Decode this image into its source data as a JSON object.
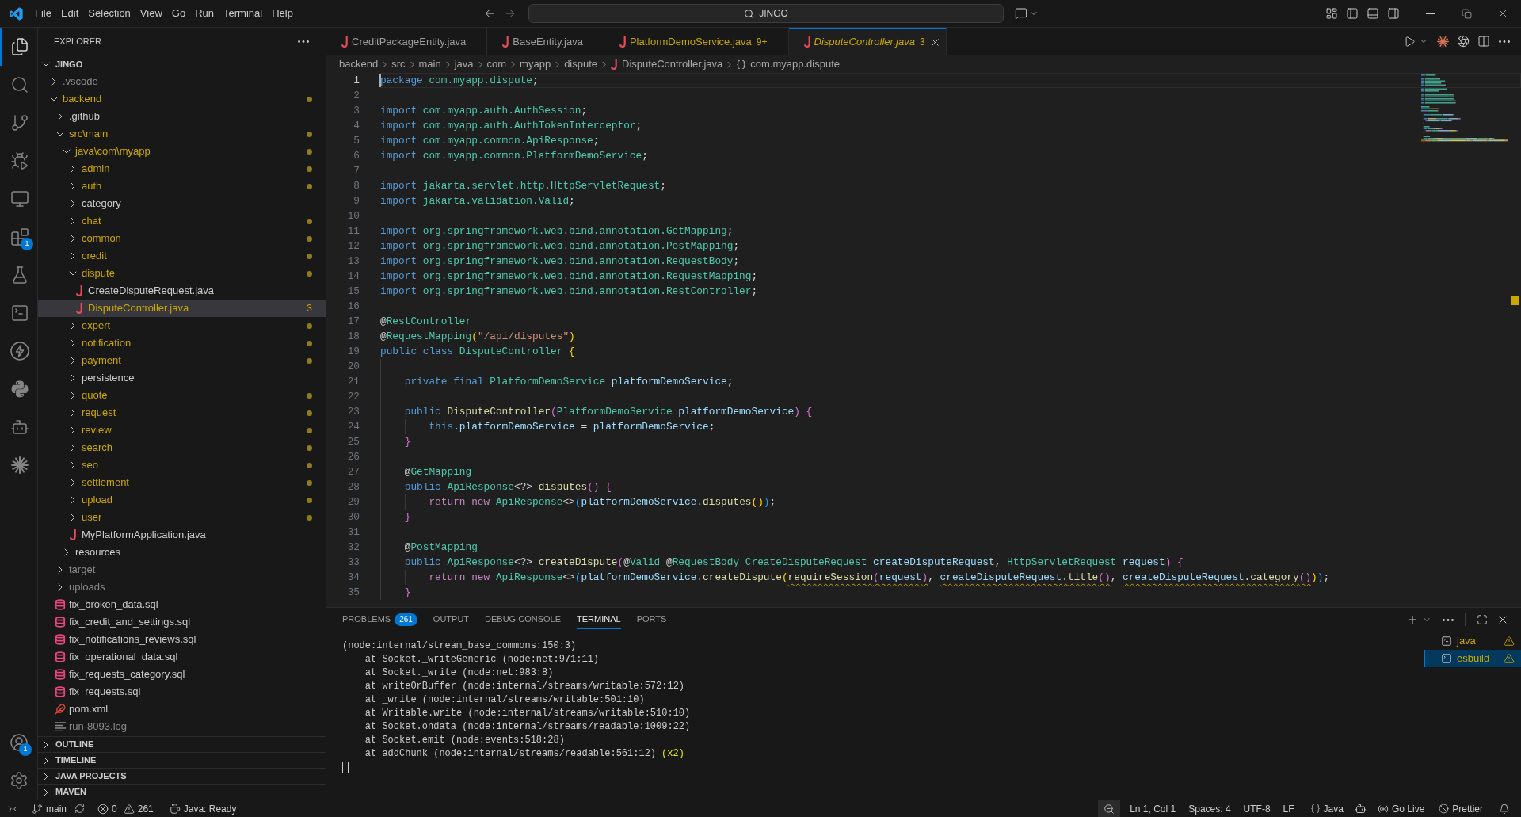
{
  "title_bar": {
    "menu": [
      "File",
      "Edit",
      "Selection",
      "View",
      "Go",
      "Run",
      "Terminal",
      "Help"
    ],
    "command_center": {
      "label": "JINGO"
    }
  },
  "activity_bar": {
    "items": [
      {
        "selected": true
      },
      {
        "selected": false
      },
      {
        "selected": false
      },
      {
        "selected": false
      },
      {
        "selected": false
      },
      {
        "selected": false,
        "badge": "1"
      },
      {
        "selected": false
      },
      {
        "selected": false
      },
      {
        "selected": false
      },
      {
        "selected": false
      },
      {
        "selected": false
      },
      {
        "selected": false
      }
    ],
    "accounts": {
      "badge": "1"
    }
  },
  "sidebar": {
    "title": "EXPLORER",
    "workspace": {
      "name": "JINGO",
      "expanded": true
    },
    "tree": [
      {
        "name": ".vscode",
        "kind": "folder",
        "expanded": false,
        "warning": false,
        "dimmed": true,
        "selected": false
      },
      {
        "name": "backend",
        "kind": "folder",
        "expanded": true,
        "warning": true,
        "dimmed": false,
        "selected": false,
        "children": [
          {
            "name": ".github",
            "kind": "folder",
            "expanded": false,
            "warning": false,
            "dimmed": false,
            "selected": false
          },
          {
            "name": "src\\main",
            "kind": "folder",
            "expanded": true,
            "warning": true,
            "dimmed": false,
            "selected": false,
            "children": [
              {
                "name": "java\\com\\myapp",
                "kind": "folder",
                "expanded": true,
                "warning": true,
                "dimmed": false,
                "selected": false,
                "children": [
                  {
                    "name": "admin",
                    "kind": "folder",
                    "expanded": false,
                    "warning": true,
                    "dimmed": false,
                    "selected": false
                  },
                  {
                    "name": "auth",
                    "kind": "folder",
                    "expanded": false,
                    "warning": true,
                    "dimmed": false,
                    "selected": false
                  },
                  {
                    "name": "category",
                    "kind": "folder",
                    "expanded": false,
                    "warning": false,
                    "dimmed": false,
                    "selected": false
                  },
                  {
                    "name": "chat",
                    "kind": "folder",
                    "expanded": false,
                    "warning": true,
                    "dimmed": false,
                    "selected": false
                  },
                  {
                    "name": "common",
                    "kind": "folder",
                    "expanded": false,
                    "warning": true,
                    "dimmed": false,
                    "selected": false
                  },
                  {
                    "name": "credit",
                    "kind": "folder",
                    "expanded": false,
                    "warning": true,
                    "dimmed": false,
                    "selected": false
                  },
                  {
                    "name": "dispute",
                    "kind": "folder",
                    "expanded": true,
                    "warning": true,
                    "dimmed": false,
                    "selected": false,
                    "children": [
                      {
                        "name": "CreateDisputeRequest.java",
                        "kind": "java",
                        "warning": false,
                        "dimmed": false,
                        "selected": false
                      },
                      {
                        "name": "DisputeController.java",
                        "kind": "java",
                        "warning": true,
                        "dimmed": false,
                        "selected": true,
                        "badge": "3"
                      }
                    ]
                  },
                  {
                    "name": "expert",
                    "kind": "folder",
                    "expanded": false,
                    "warning": true,
                    "dimmed": false,
                    "selected": false
                  },
                  {
                    "name": "notification",
                    "kind": "folder",
                    "expanded": false,
                    "warning": true,
                    "dimmed": false,
                    "selected": false
                  },
                  {
                    "name": "payment",
                    "kind": "folder",
                    "expanded": false,
                    "warning": true,
                    "dimmed": false,
                    "selected": false
                  },
                  {
                    "name": "persistence",
                    "kind": "folder",
                    "expanded": false,
                    "warning": false,
                    "dimmed": false,
                    "selected": false
                  },
                  {
                    "name": "quote",
                    "kind": "folder",
                    "expanded": false,
                    "warning": true,
                    "dimmed": false,
                    "selected": false
                  },
                  {
                    "name": "request",
                    "kind": "folder",
                    "expanded": false,
                    "warning": true,
                    "dimmed": false,
                    "selected": false
                  },
                  {
                    "name": "review",
                    "kind": "folder",
                    "expanded": false,
                    "warning": true,
                    "dimmed": false,
                    "selected": false
                  },
                  {
                    "name": "search",
                    "kind": "folder",
                    "expanded": false,
                    "warning": true,
                    "dimmed": false,
                    "selected": false
                  },
                  {
                    "name": "seo",
                    "kind": "folder",
                    "expanded": false,
                    "warning": true,
                    "dimmed": false,
                    "selected": false
                  },
                  {
                    "name": "settlement",
                    "kind": "folder",
                    "expanded": false,
                    "warning": true,
                    "dimmed": false,
                    "selected": false
                  },
                  {
                    "name": "upload",
                    "kind": "folder",
                    "expanded": false,
                    "warning": true,
                    "dimmed": false,
                    "selected": false
                  },
                  {
                    "name": "user",
                    "kind": "folder",
                    "expanded": false,
                    "warning": true,
                    "dimmed": false,
                    "selected": false
                  },
                  {
                    "name": "MyPlatformApplication.java",
                    "kind": "java",
                    "warning": false,
                    "dimmed": false,
                    "selected": false
                  }
                ]
              },
              {
                "name": "resources",
                "kind": "folder",
                "expanded": false,
                "warning": false,
                "dimmed": false,
                "selected": false
              }
            ]
          },
          {
            "name": "target",
            "kind": "folder",
            "expanded": false,
            "warning": false,
            "dimmed": true,
            "selected": false
          },
          {
            "name": "uploads",
            "kind": "folder",
            "expanded": false,
            "warning": false,
            "dimmed": true,
            "selected": false
          },
          {
            "name": "fix_broken_data.sql",
            "kind": "sql",
            "warning": false,
            "dimmed": false,
            "selected": false
          },
          {
            "name": "fix_credit_and_settings.sql",
            "kind": "sql",
            "warning": false,
            "dimmed": false,
            "selected": false
          },
          {
            "name": "fix_notifications_reviews.sql",
            "kind": "sql",
            "warning": false,
            "dimmed": false,
            "selected": false
          },
          {
            "name": "fix_operational_data.sql",
            "kind": "sql",
            "warning": false,
            "dimmed": false,
            "selected": false
          },
          {
            "name": "fix_requests_category.sql",
            "kind": "sql",
            "warning": false,
            "dimmed": false,
            "selected": false
          },
          {
            "name": "fix_requests.sql",
            "kind": "sql",
            "warning": false,
            "dimmed": false,
            "selected": false
          },
          {
            "name": "pom.xml",
            "kind": "xml",
            "warning": false,
            "dimmed": false,
            "selected": false
          },
          {
            "name": "run-8093.log",
            "kind": "log",
            "warning": false,
            "dimmed": true,
            "selected": false
          }
        ]
      }
    ],
    "sections": [
      {
        "name": "OUTLINE",
        "expanded": false
      },
      {
        "name": "TIMELINE",
        "expanded": false
      },
      {
        "name": "JAVA PROJECTS",
        "expanded": false
      },
      {
        "name": "MAVEN",
        "expanded": false
      }
    ]
  },
  "editor": {
    "tabs": [
      {
        "name": "CreditPackageEntity.java",
        "selected": false,
        "preview": false,
        "warning": false
      },
      {
        "name": "BaseEntity.java",
        "selected": false,
        "preview": false,
        "warning": false
      },
      {
        "name": "PlatformDemoService.java",
        "selected": false,
        "preview": false,
        "warning": true,
        "problems": "9+"
      },
      {
        "name": "DisputeController.java",
        "selected": true,
        "preview": true,
        "warning": true,
        "problems": "3"
      }
    ],
    "breadcrumb": [
      {
        "label": "backend",
        "kind": "folder"
      },
      {
        "label": "src",
        "kind": "folder"
      },
      {
        "label": "main",
        "kind": "folder"
      },
      {
        "label": "java",
        "kind": "folder"
      },
      {
        "label": "com",
        "kind": "folder"
      },
      {
        "label": "myapp",
        "kind": "folder"
      },
      {
        "label": "dispute",
        "kind": "folder"
      },
      {
        "label": "DisputeController.java",
        "kind": "file"
      },
      {
        "label": "com.myapp.dispute",
        "kind": "symbol"
      }
    ],
    "lines": [
      {
        "number": "1",
        "current": true,
        "tokens": [
          {
            "kind": "keyword",
            "text": "package "
          },
          {
            "kind": "type",
            "text": "com.myapp.dispute"
          },
          {
            "kind": "plain",
            "text": ";"
          }
        ]
      },
      {
        "number": "2",
        "current": false
      },
      {
        "number": "3",
        "current": false,
        "tokens": [
          {
            "kind": "keyword",
            "text": "import "
          },
          {
            "kind": "type",
            "text": "com.myapp.auth.AuthSession"
          },
          {
            "kind": "plain",
            "text": ";"
          }
        ]
      },
      {
        "number": "4",
        "current": false,
        "tokens": [
          {
            "kind": "keyword",
            "text": "import "
          },
          {
            "kind": "type",
            "text": "com.myapp.auth.AuthTokenInterceptor"
          },
          {
            "kind": "plain",
            "text": ";"
          }
        ]
      },
      {
        "number": "5",
        "current": false,
        "tokens": [
          {
            "kind": "keyword",
            "text": "import "
          },
          {
            "kind": "type",
            "text": "com.myapp.common.ApiResponse"
          },
          {
            "kind": "plain",
            "text": ";"
          }
        ]
      },
      {
        "number": "6",
        "current": false,
        "tokens": [
          {
            "kind": "keyword",
            "text": "import "
          },
          {
            "kind": "type",
            "text": "com.myapp.common.PlatformDemoService"
          },
          {
            "kind": "plain",
            "text": ";"
          }
        ]
      },
      {
        "number": "7",
        "current": false
      },
      {
        "number": "8",
        "current": false,
        "tokens": [
          {
            "kind": "keyword",
            "text": "import "
          },
          {
            "kind": "type",
            "text": "jakarta.servlet.http.HttpServletRequest"
          },
          {
            "kind": "plain",
            "text": ";"
          }
        ]
      },
      {
        "number": "9",
        "current": false,
        "tokens": [
          {
            "kind": "keyword",
            "text": "import "
          },
          {
            "kind": "type",
            "text": "jakarta.validation.Valid"
          },
          {
            "kind": "plain",
            "text": ";"
          }
        ]
      },
      {
        "number": "10",
        "current": false
      },
      {
        "number": "11",
        "current": false,
        "tokens": [
          {
            "kind": "keyword",
            "text": "import "
          },
          {
            "kind": "type",
            "text": "org.springframework.web.bind.annotation.GetMapping"
          },
          {
            "kind": "plain",
            "text": ";"
          }
        ]
      },
      {
        "number": "12",
        "current": false,
        "tokens": [
          {
            "kind": "keyword",
            "text": "import "
          },
          {
            "kind": "type",
            "text": "org.springframework.web.bind.annotation.PostMapping"
          },
          {
            "kind": "plain",
            "text": ";"
          }
        ]
      },
      {
        "number": "13",
        "current": false,
        "tokens": [
          {
            "kind": "keyword",
            "text": "import "
          },
          {
            "kind": "type",
            "text": "org.springframework.web.bind.annotation.RequestBody"
          },
          {
            "kind": "plain",
            "text": ";"
          }
        ]
      },
      {
        "number": "14",
        "current": false,
        "tokens": [
          {
            "kind": "keyword",
            "text": "import "
          },
          {
            "kind": "type",
            "text": "org.springframework.web.bind.annotation.RequestMapping"
          },
          {
            "kind": "plain",
            "text": ";"
          }
        ]
      },
      {
        "number": "15",
        "current": false,
        "tokens": [
          {
            "kind": "keyword",
            "text": "import "
          },
          {
            "kind": "type",
            "text": "org.springframework.web.bind.annotation.RestController"
          },
          {
            "kind": "plain",
            "text": ";"
          }
        ]
      },
      {
        "number": "16",
        "current": false
      },
      {
        "number": "17",
        "current": false,
        "tokens": [
          {
            "kind": "plain",
            "text": "@"
          },
          {
            "kind": "type",
            "text": "RestController"
          }
        ]
      },
      {
        "number": "18",
        "current": false,
        "tokens": [
          {
            "kind": "plain",
            "text": "@"
          },
          {
            "kind": "type",
            "text": "RequestMapping"
          },
          {
            "kind": "bracket1",
            "text": "("
          },
          {
            "kind": "string",
            "text": "\"/api/disputes\""
          },
          {
            "kind": "bracket1",
            "text": ")"
          }
        ]
      },
      {
        "number": "19",
        "current": false,
        "tokens": [
          {
            "kind": "keyword",
            "text": "public class "
          },
          {
            "kind": "type",
            "text": "DisputeController "
          },
          {
            "kind": "bracket1",
            "text": "{"
          }
        ]
      },
      {
        "number": "20",
        "current": false
      },
      {
        "number": "21",
        "current": false,
        "tokens": [
          {
            "kind": "keyword",
            "text": "    private final "
          },
          {
            "kind": "type",
            "text": "PlatformDemoService "
          },
          {
            "kind": "variable",
            "text": "platformDemoService"
          },
          {
            "kind": "plain",
            "text": ";"
          }
        ]
      },
      {
        "number": "22",
        "current": false
      },
      {
        "number": "23",
        "current": false,
        "tokens": [
          {
            "kind": "keyword",
            "text": "    public "
          },
          {
            "kind": "function",
            "text": "DisputeController"
          },
          {
            "kind": "bracket2",
            "text": "("
          },
          {
            "kind": "type",
            "text": "PlatformDemoService "
          },
          {
            "kind": "variable",
            "text": "platformDemoService"
          },
          {
            "kind": "bracket2",
            "text": ") {"
          }
        ]
      },
      {
        "number": "24",
        "current": false,
        "tokens": [
          {
            "kind": "keyword",
            "text": "        this"
          },
          {
            "kind": "plain",
            "text": "."
          },
          {
            "kind": "variable",
            "text": "platformDemoService"
          },
          {
            "kind": "plain",
            "text": " = "
          },
          {
            "kind": "variable",
            "text": "platformDemoService"
          },
          {
            "kind": "plain",
            "text": ";"
          }
        ]
      },
      {
        "number": "25",
        "current": false,
        "tokens": [
          {
            "kind": "bracket2",
            "text": "    }"
          }
        ]
      },
      {
        "number": "26",
        "current": false
      },
      {
        "number": "27",
        "current": false,
        "tokens": [
          {
            "kind": "plain",
            "text": "    @"
          },
          {
            "kind": "type",
            "text": "GetMapping"
          }
        ]
      },
      {
        "number": "28",
        "current": false,
        "tokens": [
          {
            "kind": "keyword",
            "text": "    public "
          },
          {
            "kind": "type",
            "text": "ApiResponse"
          },
          {
            "kind": "plain",
            "text": "<?> "
          },
          {
            "kind": "function",
            "text": "disputes"
          },
          {
            "kind": "bracket2",
            "text": "() {"
          }
        ]
      },
      {
        "number": "29",
        "current": false,
        "tokens": [
          {
            "kind": "control",
            "text": "        return new "
          },
          {
            "kind": "type",
            "text": "ApiResponse"
          },
          {
            "kind": "plain",
            "text": "<>"
          },
          {
            "kind": "bracket3",
            "text": "("
          },
          {
            "kind": "variable",
            "text": "platformDemoService"
          },
          {
            "kind": "plain",
            "text": "."
          },
          {
            "kind": "function",
            "text": "disputes"
          },
          {
            "kind": "bracket1",
            "text": "()"
          },
          {
            "kind": "bracket3",
            "text": ")"
          },
          {
            "kind": "plain",
            "text": ";"
          }
        ]
      },
      {
        "number": "30",
        "current": false,
        "tokens": [
          {
            "kind": "bracket2",
            "text": "    }"
          }
        ]
      },
      {
        "number": "31",
        "current": false
      },
      {
        "number": "32",
        "current": false,
        "tokens": [
          {
            "kind": "plain",
            "text": "    @"
          },
          {
            "kind": "type",
            "text": "PostMapping"
          }
        ]
      },
      {
        "number": "33",
        "current": false,
        "tokens": [
          {
            "kind": "keyword",
            "text": "    public "
          },
          {
            "kind": "type",
            "text": "ApiResponse"
          },
          {
            "kind": "plain",
            "text": "<?> "
          },
          {
            "kind": "function",
            "text": "createDispute"
          },
          {
            "kind": "bracket2",
            "text": "("
          },
          {
            "kind": "plain",
            "text": "@"
          },
          {
            "kind": "type",
            "text": "Valid"
          },
          {
            "kind": "plain",
            "text": " @"
          },
          {
            "kind": "type",
            "text": "RequestBody CreateDisputeRequest "
          },
          {
            "kind": "variable",
            "text": "createDisputeRequest"
          },
          {
            "kind": "plain",
            "text": ", "
          },
          {
            "kind": "type",
            "text": "HttpServletRequest "
          },
          {
            "kind": "variable",
            "text": "request"
          },
          {
            "kind": "bracket2",
            "text": ") {"
          }
        ]
      },
      {
        "number": "34",
        "current": false,
        "tokens": [
          {
            "kind": "control",
            "text": "        return new "
          },
          {
            "kind": "type",
            "text": "ApiResponse"
          },
          {
            "kind": "plain",
            "text": "<>"
          },
          {
            "kind": "bracket3",
            "text": "("
          },
          {
            "kind": "variable",
            "text": "platformDemoService"
          },
          {
            "kind": "plain",
            "text": "."
          },
          {
            "kind": "function",
            "text": "createDispute"
          },
          {
            "kind": "bracket1",
            "text": "("
          },
          {
            "kind": "warning",
            "tokens": [
              {
                "kind": "function",
                "text": "requireSession"
              },
              {
                "kind": "bracket2",
                "text": "("
              },
              {
                "kind": "variable",
                "text": "request"
              },
              {
                "kind": "bracket2",
                "text": ")"
              }
            ]
          },
          {
            "kind": "plain",
            "text": ", "
          },
          {
            "kind": "warning",
            "tokens": [
              {
                "kind": "variable",
                "text": "createDisputeRequest"
              },
              {
                "kind": "plain",
                "text": "."
              },
              {
                "kind": "function",
                "text": "title"
              },
              {
                "kind": "bracket2",
                "text": "()"
              }
            ]
          },
          {
            "kind": "plain",
            "text": ", "
          },
          {
            "kind": "warning",
            "tokens": [
              {
                "kind": "variable",
                "text": "createDisputeRequest"
              },
              {
                "kind": "plain",
                "text": "."
              },
              {
                "kind": "function",
                "text": "category"
              },
              {
                "kind": "bracket2",
                "text": "()"
              }
            ]
          },
          {
            "kind": "bracket1",
            "text": ")"
          },
          {
            "kind": "bracket3",
            "text": ")"
          },
          {
            "kind": "plain",
            "text": ";"
          }
        ]
      },
      {
        "number": "35",
        "current": false,
        "tokens": [
          {
            "kind": "bracket2",
            "text": "    }"
          }
        ]
      }
    ]
  },
  "panel": {
    "tabs": [
      {
        "label": "PROBLEMS",
        "selected": false,
        "badge": "261"
      },
      {
        "label": "OUTPUT",
        "selected": false
      },
      {
        "label": "DEBUG CONSOLE",
        "selected": false
      },
      {
        "label": "TERMINAL",
        "selected": true
      },
      {
        "label": "PORTS",
        "selected": false
      }
    ],
    "terminal": {
      "lines": [
        {
          "text": "(node:internal/stream_base_commons:150:3)"
        },
        {
          "text": "    at Socket._writeGeneric (node:net:971:11)"
        },
        {
          "text": "    at Socket._write (node:net:983:8)"
        },
        {
          "text": "    at writeOrBuffer (node:internal/streams/writable:572:12)"
        },
        {
          "text": "    at _write (node:internal/streams/writable:501:10)"
        },
        {
          "text": "    at Writable.write (node:internal/streams/writable:510:10)"
        },
        {
          "text": "    at Socket.ondata (node:internal/streams/readable:1009:22)"
        },
        {
          "text": "    at Socket.emit (node:events:518:28)"
        },
        {
          "text": "    at addChunk (node:internal/streams/readable:561:12)",
          "note": "(x2)"
        }
      ]
    },
    "instances": [
      {
        "name": "java",
        "selected": false,
        "warning": true
      },
      {
        "name": "esbuild",
        "selected": true,
        "warning": true
      }
    ]
  },
  "status_bar": {
    "branch": "main",
    "errors": "0",
    "warnings": "261",
    "java_status": "Java: Ready",
    "cursor_position": "Ln 1, Col 1",
    "indentation": "Spaces: 4",
    "encoding": "UTF-8",
    "line_ending": "LF",
    "language": "Java",
    "live_server": "Go Live",
    "formatter": "Prettier"
  }
}
